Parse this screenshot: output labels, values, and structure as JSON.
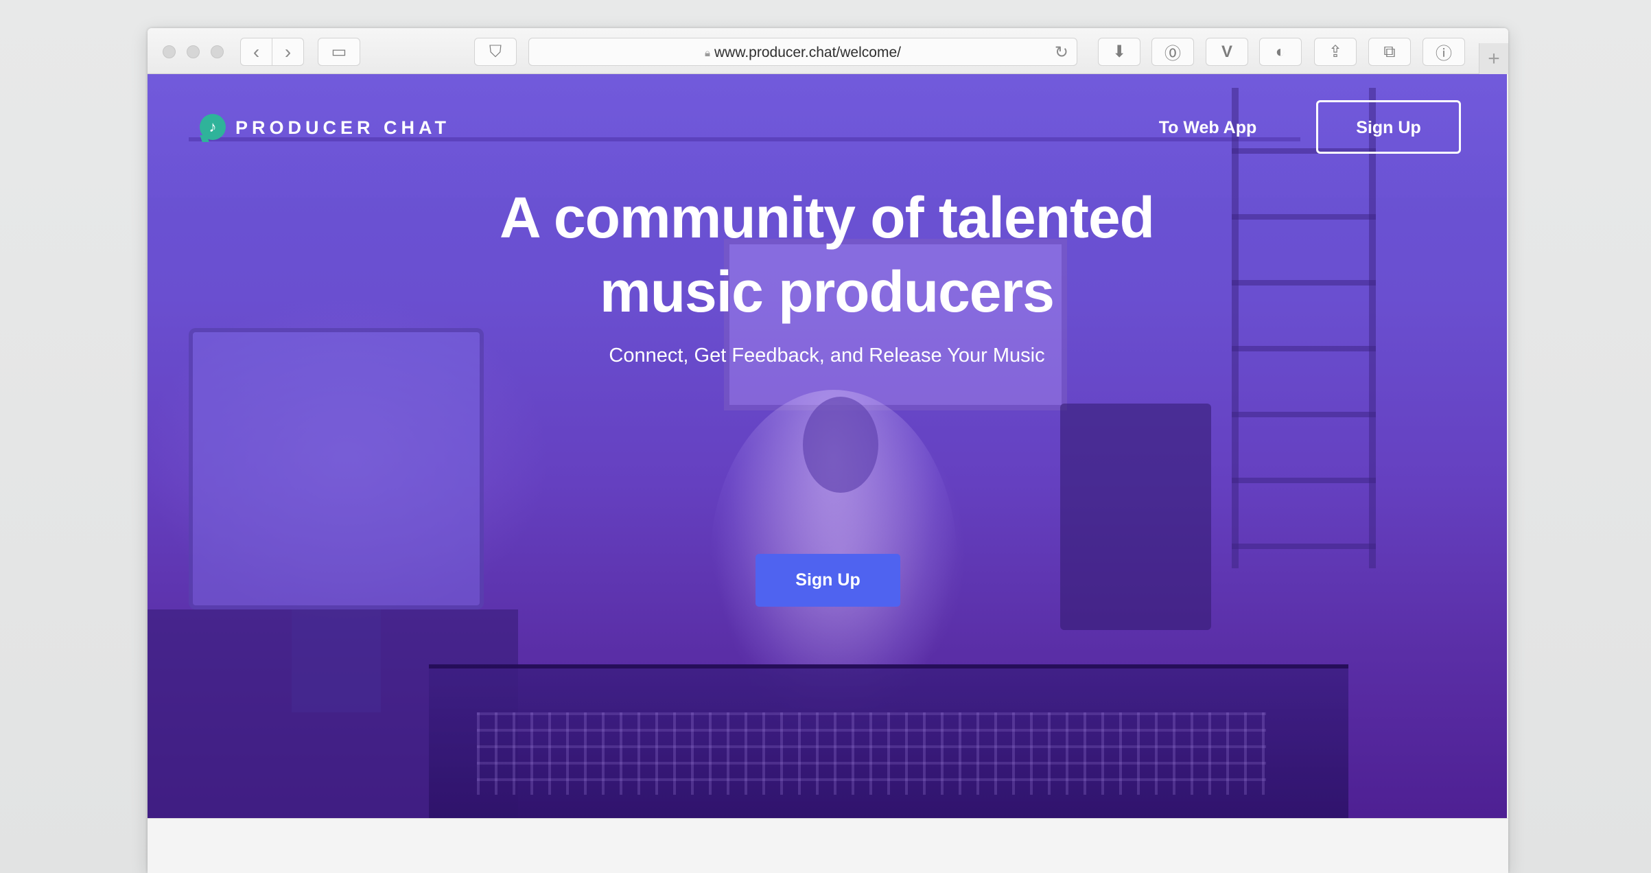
{
  "browser": {
    "url": "www.producer.chat/welcome/",
    "icons": [
      "back-icon",
      "forward-icon",
      "sidebar-icon",
      "pocket-icon",
      "lock-icon",
      "reload-icon",
      "download-icon",
      "password-icon",
      "vimeo-icon",
      "extension-icon",
      "share-icon",
      "tabs-icon",
      "info-icon",
      "new-tab-icon"
    ]
  },
  "site": {
    "brand": "PRODUCER CHAT",
    "brand_color": "#2fb39a",
    "nav": {
      "web_app_link": "To Web App",
      "signup_button": "Sign Up"
    },
    "hero": {
      "headline_line1": "A community of talented",
      "headline_line2": "music producers",
      "subheadline": "Connect, Get Feedback, and Release Your Music",
      "cta_button": "Sign Up",
      "cta_color": "#4f63f0",
      "overlay_color": "#6540c0"
    }
  }
}
